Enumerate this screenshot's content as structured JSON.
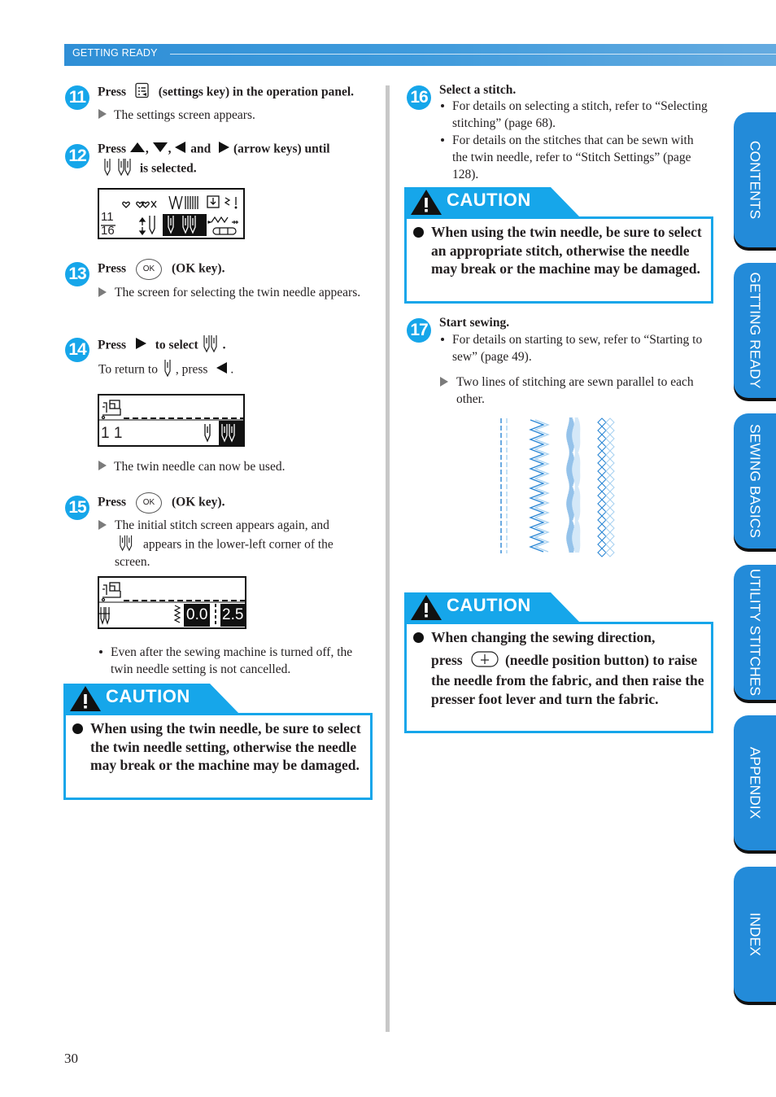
{
  "header": {
    "section": "GETTING READY"
  },
  "colors": {
    "accent": "#16a6ea",
    "header_blue": "#2f8fd6",
    "side_tab": "#238bd9"
  },
  "steps": {
    "s11": {
      "num": "11",
      "press": "Press",
      "rest": "(settings key) in the operation panel.",
      "result": "The settings screen appears.",
      "icon": "settings-key-icon"
    },
    "s12": {
      "num": "12",
      "press": "Press",
      "sep1": ",",
      "sep2": ",",
      "and": "and",
      "rest": "(arrow keys) until",
      "line2": "is selected."
    },
    "s13": {
      "num": "13",
      "press": "Press",
      "ok": "OK",
      "rest": "(OK key).",
      "result": "The screen for selecting the twin needle appears."
    },
    "s14": {
      "num": "14",
      "press": "Press",
      "rest": "to select",
      "period": ".",
      "return_pre": "To return to",
      "return_mid": ", press",
      "return_end": ".",
      "result": "The twin needle can now be used."
    },
    "s15": {
      "num": "15",
      "press": "Press",
      "ok": "OK",
      "rest": "(OK key).",
      "result_a": "The initial stitch screen appears again, and",
      "result_b": "appears in the lower-left corner of the",
      "result_c": "screen.",
      "note": "Even after the sewing machine is turned off, the twin needle setting is not cancelled."
    },
    "s16": {
      "num": "16",
      "title": "Select a stitch.",
      "bullets": [
        "For details on selecting a stitch, refer to “Selecting stitching” (page 68).",
        "For details on the stitches that can be sewn with the twin needle, refer to “Stitch Settings” (page 128)."
      ]
    },
    "s17": {
      "num": "17",
      "title": "Start sewing.",
      "bullets": [
        "For details on starting to sew, refer to “Starting to sew” (page 49)."
      ],
      "result": "Two lines of stitching are sewn parallel to each other."
    }
  },
  "lcd1": {
    "top_icons": "♡ ♡♡",
    "frac_top": "11",
    "frac_bottom": "16"
  },
  "lcd2": {
    "number": "1 1"
  },
  "lcd3": {
    "width": "0.0",
    "length": "2.5"
  },
  "cautions": {
    "label": "CAUTION",
    "c1": "When using the twin needle, be sure to select the twin needle setting, otherwise the needle may break or the machine may be damaged.",
    "c2": "When using the twin needle, be sure to select an appropriate stitch, otherwise the needle may break or the machine may be damaged.",
    "c3_pre": "When changing the sewing direction,",
    "c3_press": "press",
    "c3_post": "(needle position button) to raise the needle from the fabric, and then raise the presser foot lever and turn the fabric."
  },
  "side_tabs": [
    "CONTENTS",
    "GETTING READY",
    "SEWING BASICS",
    "UTILITY STITCHES",
    "APPENDIX",
    "INDEX"
  ],
  "page_number": "30"
}
